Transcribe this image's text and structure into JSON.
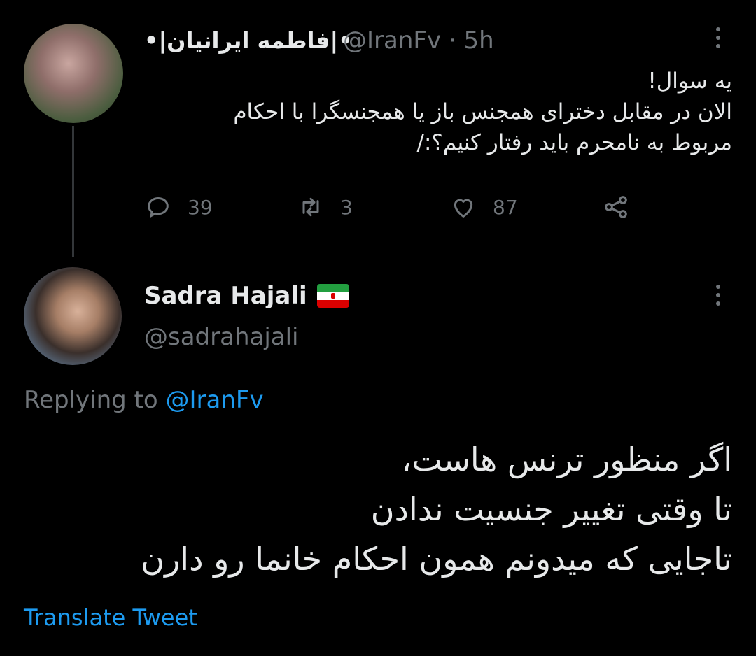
{
  "original_tweet": {
    "display_name": "•|فاطمه ایرانیان|•",
    "handle": "@IranFv",
    "separator": "·",
    "time": "5h",
    "text_lines": [
      "یه سوال!",
      "الان در مقابل دخترای همجنس باز یا همجنسگرا با احکام",
      "مربوط به نامحرم باید رفتار کنیم؟:/"
    ],
    "actions": {
      "reply_count": "39",
      "retweet_count": "3",
      "like_count": "87"
    },
    "more_icon": "more-vertical-icon"
  },
  "reply_tweet": {
    "display_name": "Sadra Hajali",
    "flag": "iran-flag-icon",
    "handle": "@sadrahajali",
    "replying_prefix": "Replying to",
    "replying_to": "@IranFv",
    "text_lines": [
      "اگر منظور ترنس هاست،",
      "تا وقتی تغییر جنسیت ندادن",
      "تاجایی که میدونم همون احکام خانما رو دارن"
    ],
    "translate_label": "Translate Tweet",
    "more_icon": "more-vertical-icon"
  },
  "colors": {
    "background": "#000000",
    "text": "#e7e9ea",
    "secondary": "#71767b",
    "accent": "#1d9bf0"
  }
}
